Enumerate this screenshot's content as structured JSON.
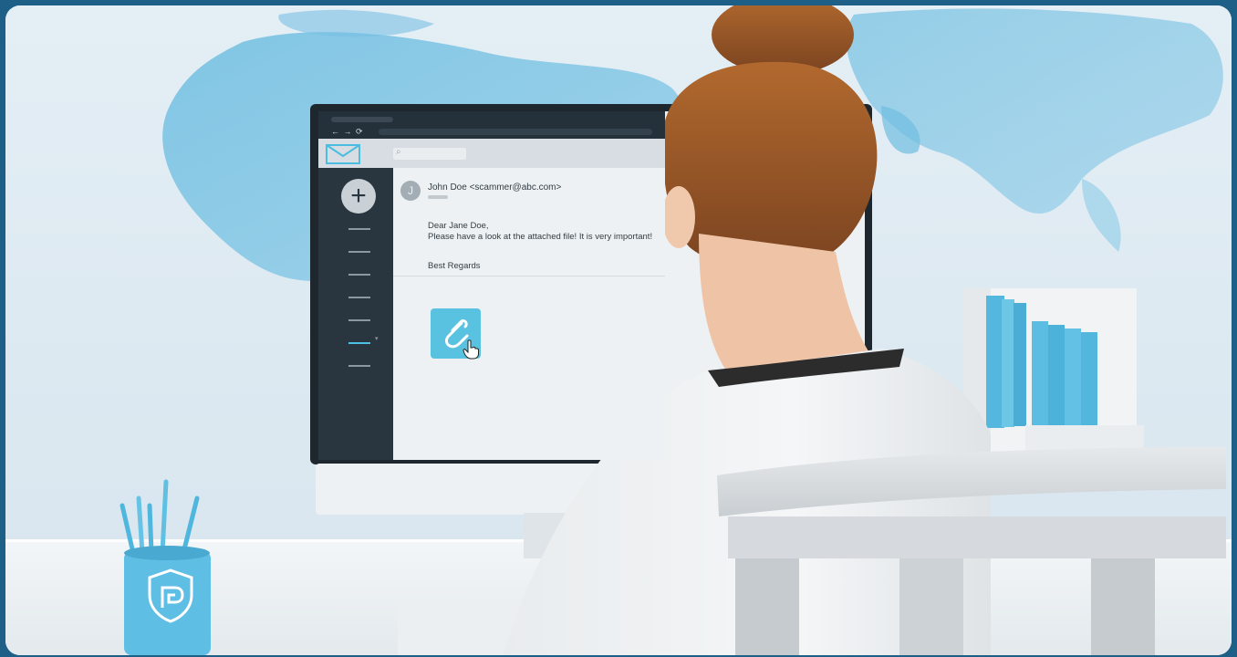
{
  "colors": {
    "frame": "#1d5f86",
    "accent": "#58c2e0",
    "screen_dark": "#24313a",
    "sidebar": "#2a363f",
    "mail_bg": "#eef1f3"
  },
  "icons": {
    "app_logo": "envelope-icon",
    "compose": "plus-icon",
    "attachment": "paperclip-icon",
    "cursor": "hand-pointer-icon",
    "search": "search-icon",
    "shield": "shield-icon"
  },
  "browser": {
    "nav_icons": "← → ⟳"
  },
  "sidebar": {
    "compose_glyph": "+"
  },
  "email": {
    "avatar_letter": "J",
    "sender": "John Doe <scammer@abc.com>",
    "greeting": "Dear Jane Doe,",
    "body": "Please have a look at the attached file! It is very important!",
    "signoff": "Best Regards"
  }
}
